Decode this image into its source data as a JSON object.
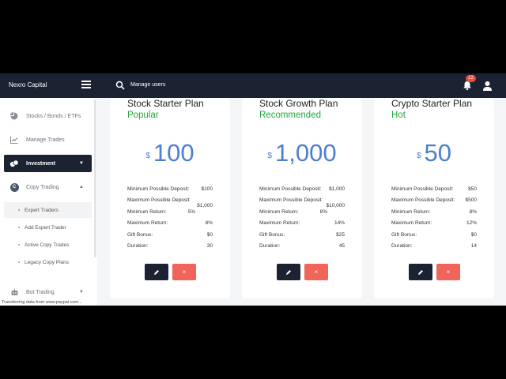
{
  "app": {
    "brand": "Nexro Capital"
  },
  "header": {
    "search_label": "Manage users",
    "notification_count": "12"
  },
  "sidebar": {
    "items": [
      {
        "label": "Stocks / Bonds / ETFs",
        "icon": "pie-chart-icon"
      },
      {
        "label": "Manage Trades",
        "icon": "chart-line-icon"
      },
      {
        "label": "Investment",
        "icon": "coins-icon",
        "active": true
      },
      {
        "label": "Copy Trading",
        "icon": "copy-c-icon"
      },
      {
        "label": "Bot Trading",
        "icon": "robot-icon"
      }
    ],
    "copy_icon_letter": "C",
    "submenu": [
      {
        "label": "Expert Traders"
      },
      {
        "label": "Add Expert Trader"
      },
      {
        "label": "Active Copy Trades"
      },
      {
        "label": "Legacy Copy Plans"
      }
    ]
  },
  "status_bar": {
    "text": "Transferring data from www.paypal.com..."
  },
  "row_labels": {
    "min_deposit": "Minimum Possible Deposit:",
    "max_deposit": "Maximum Possible Deposit:",
    "min_return": "Minimum Return:",
    "max_return": "Maximum Return:",
    "gift_bonus": "Gift Bonus:",
    "duration": "Duration:"
  },
  "plans": [
    {
      "name": "Stock Starter Plan",
      "tag": "Popular",
      "currency": "$",
      "amount": "100",
      "min_deposit": "$100",
      "max_deposit": "$1,000",
      "min_return": "5%",
      "max_return": "8%",
      "gift_bonus": "$0",
      "duration": "30"
    },
    {
      "name": "Stock Growth Plan",
      "tag": "Recommended",
      "currency": "$",
      "amount": "1,000",
      "min_deposit": "$1,000",
      "max_deposit": "$10,000",
      "min_return": "8%",
      "max_return": "14%",
      "gift_bonus": "$25",
      "duration": "45"
    },
    {
      "name": "Crypto Starter Plan",
      "tag": "Hot",
      "currency": "$",
      "amount": "50",
      "min_deposit": "$50",
      "max_deposit": "$500",
      "min_return": "8%",
      "max_return": "12%",
      "gift_bonus": "$0",
      "duration": "14"
    }
  ],
  "buttons": {
    "edit_icon": "pencil-icon",
    "delete_glyph": "×"
  },
  "colors": {
    "navy": "#1b2333",
    "accent_blue": "#4d7fd0",
    "tag_green": "#22a83a",
    "delete_red": "#f0645a",
    "badge_red": "#e74c3c"
  }
}
